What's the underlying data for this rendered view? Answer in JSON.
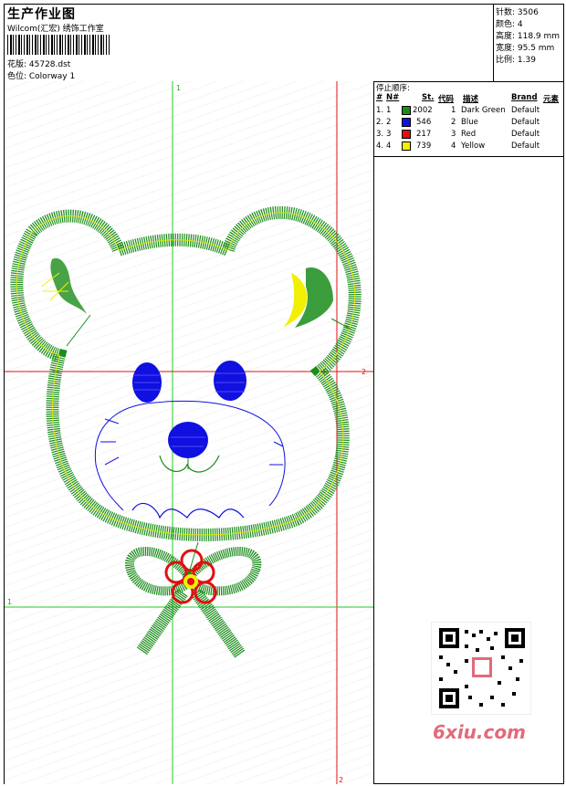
{
  "header": {
    "title": "生产作业图",
    "subtitle": "Wilcom(汇宏) 绣饰工作室",
    "design_label": "花版: 45728.dst",
    "colorway_label": "色位: Colorway 1"
  },
  "stats": [
    {
      "label": "针数: 3506"
    },
    {
      "label": "颜色: 4"
    },
    {
      "label": "高度: 118.9 mm"
    },
    {
      "label": "宽度: 95.5 mm"
    },
    {
      "label": "比例: 1.39"
    }
  ],
  "stop_sequence": {
    "title": "停止顺序:",
    "columns": [
      "#",
      "N#",
      "St.",
      "代码",
      "描述",
      "Brand",
      "元素"
    ],
    "rows": [
      {
        "idx": "1.",
        "n": "1",
        "color": "#1a8c1a",
        "stitches": "2002",
        "code": "1",
        "desc": "Dark Green",
        "brand": "Default"
      },
      {
        "idx": "2.",
        "n": "2",
        "color": "#1010e0",
        "stitches": "546",
        "code": "2",
        "desc": "Blue",
        "brand": "Default"
      },
      {
        "idx": "3.",
        "n": "3",
        "color": "#e01010",
        "stitches": "217",
        "code": "3",
        "desc": "Red",
        "brand": "Default"
      },
      {
        "idx": "4.",
        "n": "4",
        "color": "#f0f000",
        "stitches": "739",
        "code": "4",
        "desc": "Yellow",
        "brand": "Default"
      }
    ]
  },
  "guides": {
    "v1": "1",
    "h2": "2",
    "h1": "1",
    "v2": "2"
  },
  "watermark": "6xiu.com"
}
